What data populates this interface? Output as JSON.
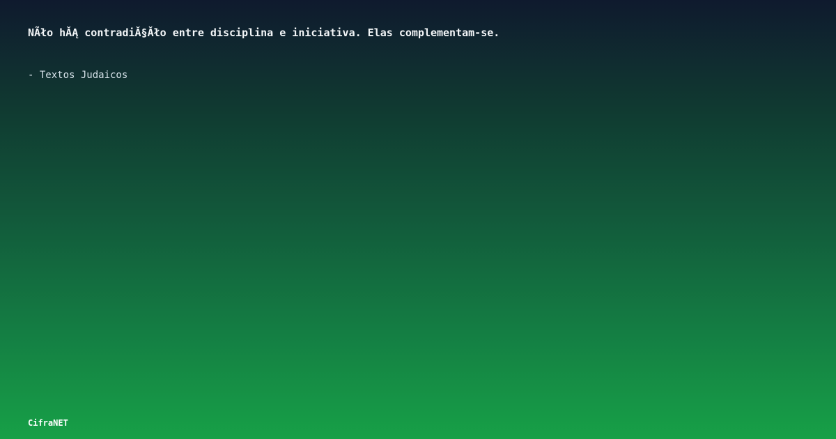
{
  "quote": {
    "text": "NÃło hĂĄ contradiĂ§Ăło entre disciplina e iniciativa. Elas complementam-se.",
    "author": "- Textos Judaicos"
  },
  "brand": {
    "name": "CifraNET"
  },
  "colors": {
    "gradient_top": "#0f1a2e",
    "gradient_bottom": "#17a047",
    "text": "#ffffff"
  }
}
